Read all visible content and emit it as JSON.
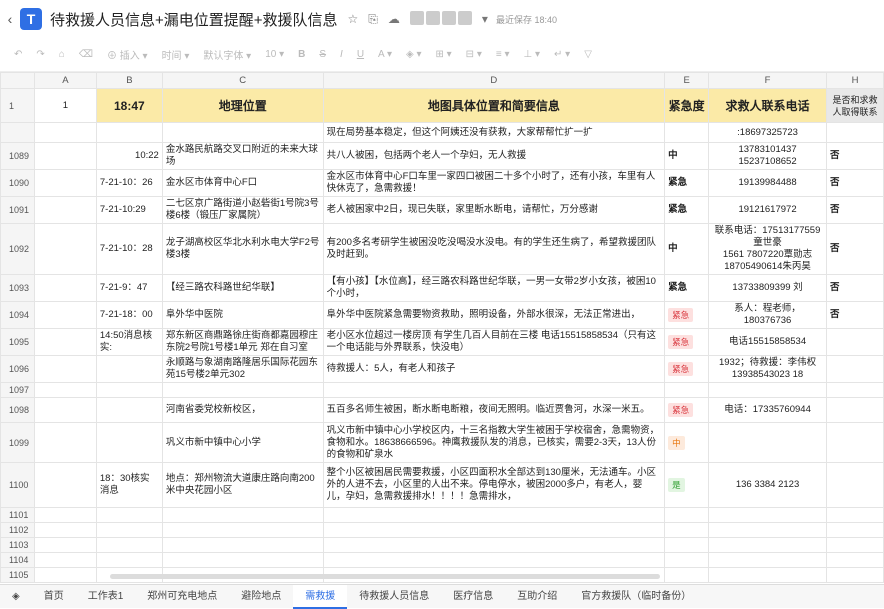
{
  "title": "待救援人员信息+漏电位置提醒+救援队信息",
  "save_status": "最近保存 18:40",
  "toolbar": {
    "insert": "插入",
    "time": "时间",
    "font": "默认字体",
    "size": "10"
  },
  "columns": [
    "A",
    "B",
    "C",
    "D",
    "E",
    "F",
    "H"
  ],
  "header_row": {
    "num": "1",
    "a": "1",
    "b": "18:47",
    "c": "地理位置",
    "d": "地图具体位置和简要信息",
    "e": "紧急度",
    "f": "求救人联系电话",
    "h": "是否和求救人取得联系"
  },
  "rows": [
    {
      "num": "",
      "b": "",
      "c": "",
      "d": "现在局势基本稳定，但这个阿姨还没有获救，大家帮帮忙扩一扩",
      "e": "",
      "f": ":18697325723",
      "h": ""
    },
    {
      "num": "1089",
      "b": "10:22",
      "c": "金水路民航路交叉口附近的未来大球场",
      "d": "共八人被困，包括两个老人一个孕妇，无人救援",
      "e": "中",
      "f": "13783101437\n15237108652",
      "h": "否"
    },
    {
      "num": "1090",
      "b": "7-21-10：26",
      "c": "金水区市体育中心F口",
      "d": "金水区市体育中心F口车里一家四口被困二十多个小时了，还有小孩，车里有人快休克了，急需救援！",
      "e": "紧急",
      "f": "19139984488",
      "h": "否"
    },
    {
      "num": "1091",
      "b": "7-21-10:29",
      "c": "二七区京广路街道小赵砦街1号院3号楼6楼（锻压厂家属院）",
      "d": "老人被困家中2日，现已失联，家里断水断电，请帮忙，万分感谢",
      "e": "紧急",
      "f": "19121617972",
      "h": "否"
    },
    {
      "num": "1092",
      "b": "7-21-10：28",
      "c": "龙子湖高校区华北水利水电大学F2号楼3楼",
      "d": "有200多名考研学生被困没吃没喝没水没电。有的学生还生病了，希望救援团队及时赶到。",
      "e": "中",
      "f": "联系电话：17513177559 童世豪\n1561 7807220覃勋志\n18705490614朱丙昊",
      "h": "否"
    },
    {
      "num": "1093",
      "b": "7-21-9：47",
      "c": "【经三路农科路世纪华联】",
      "d": "【有小孩】【水位高】，经三路农科路世纪华联，一男一女带2岁小女孩，被困10个小时，",
      "e": "紧急",
      "f": "13733809399  刘",
      "h": "否"
    },
    {
      "num": "1094",
      "b": "7-21-18：00",
      "c": "阜外华中医院",
      "d": "阜外华中医院紧急需要物资救助，照明设备，外部水很深，无法正常进出，",
      "e": "紧急",
      "f": "系人：程老师，180376736",
      "h": "否"
    },
    {
      "num": "1095",
      "b": "14:50消息核实:",
      "c": "郑东新区商鼎路徐庄街商都嘉园穆庄东院2号院1号楼1单元 郑在自习室",
      "d": "老小区水位超过一楼房顶 有学生几百人目前在三楼 电话15515858534（只有这一个电话能与外界联系，快没电）",
      "e": "紧急",
      "f": "电话15515858534",
      "h": ""
    },
    {
      "num": "1096",
      "b": "",
      "c": "永顺路与象湖南路隆居乐国际花园东苑15号楼2单元302",
      "d": "待救援人：5人，有老人和孩子",
      "e": "紧急",
      "f": "1932；待救援：李伟权 13938543023 18",
      "h": ""
    },
    {
      "num": "1097",
      "b": "",
      "c": "",
      "d": "",
      "e": "",
      "f": "",
      "h": ""
    },
    {
      "num": "1098",
      "b": "",
      "c": "河南省委党校新校区，",
      "d": "五百多名师生被困，断水断电断粮，夜间无照明。临近贾鲁河，水深一米五。",
      "e": "紧急",
      "f": "电话：17335760944",
      "h": ""
    },
    {
      "num": "1099",
      "b": "",
      "c": "巩义市新中镇中心小学",
      "d": "巩义市新中镇中心小学校区内，十三名指教大学生被困于学校宿舍，急需物资，食物和水。18638666596。神鹰救援队发的消息，已核实，需要2-3天，13人份的食物和矿泉水",
      "e": "中",
      "f": "",
      "h": ""
    },
    {
      "num": "1100",
      "b": "18：30核实消息",
      "c": "地点：郑州物流大道康庄路向南200米中央花园小区",
      "d": "整个小区被困居民需要救援，小区四面积水全部达到130厘米，无法通车。小区外的人进不去，小区里的人出不来。停电停水，被困2000多户，有老人，婴儿，孕妇，急需救援排水！！！！急需排水，",
      "e": "是",
      "f": "136 3384 2123",
      "h": ""
    },
    {
      "num": "1101",
      "b": "",
      "c": "",
      "d": "",
      "e": "",
      "f": "",
      "h": ""
    },
    {
      "num": "1102",
      "b": "",
      "c": "",
      "d": "",
      "e": "",
      "f": "",
      "h": ""
    },
    {
      "num": "1103",
      "b": "",
      "c": "",
      "d": "",
      "e": "",
      "f": "",
      "h": ""
    },
    {
      "num": "1104",
      "b": "",
      "c": "",
      "d": "",
      "e": "",
      "f": "",
      "h": ""
    },
    {
      "num": "1105",
      "b": "",
      "c": "",
      "d": "",
      "e": "",
      "f": "",
      "h": ""
    }
  ],
  "tabs": [
    "首页",
    "工作表1",
    "郑州可充电地点",
    "避险地点",
    "需救援",
    "待救援人员信息",
    "医疗信息",
    "互助介绍",
    "官方救援队（临时备份）"
  ],
  "colors": {
    "header_yellow": "#fbeaa7",
    "tag_red": "#d9363e",
    "tag_orange": "#e8750b",
    "tag_green": "#2f9e2f",
    "accent": "#2f6fe4"
  }
}
